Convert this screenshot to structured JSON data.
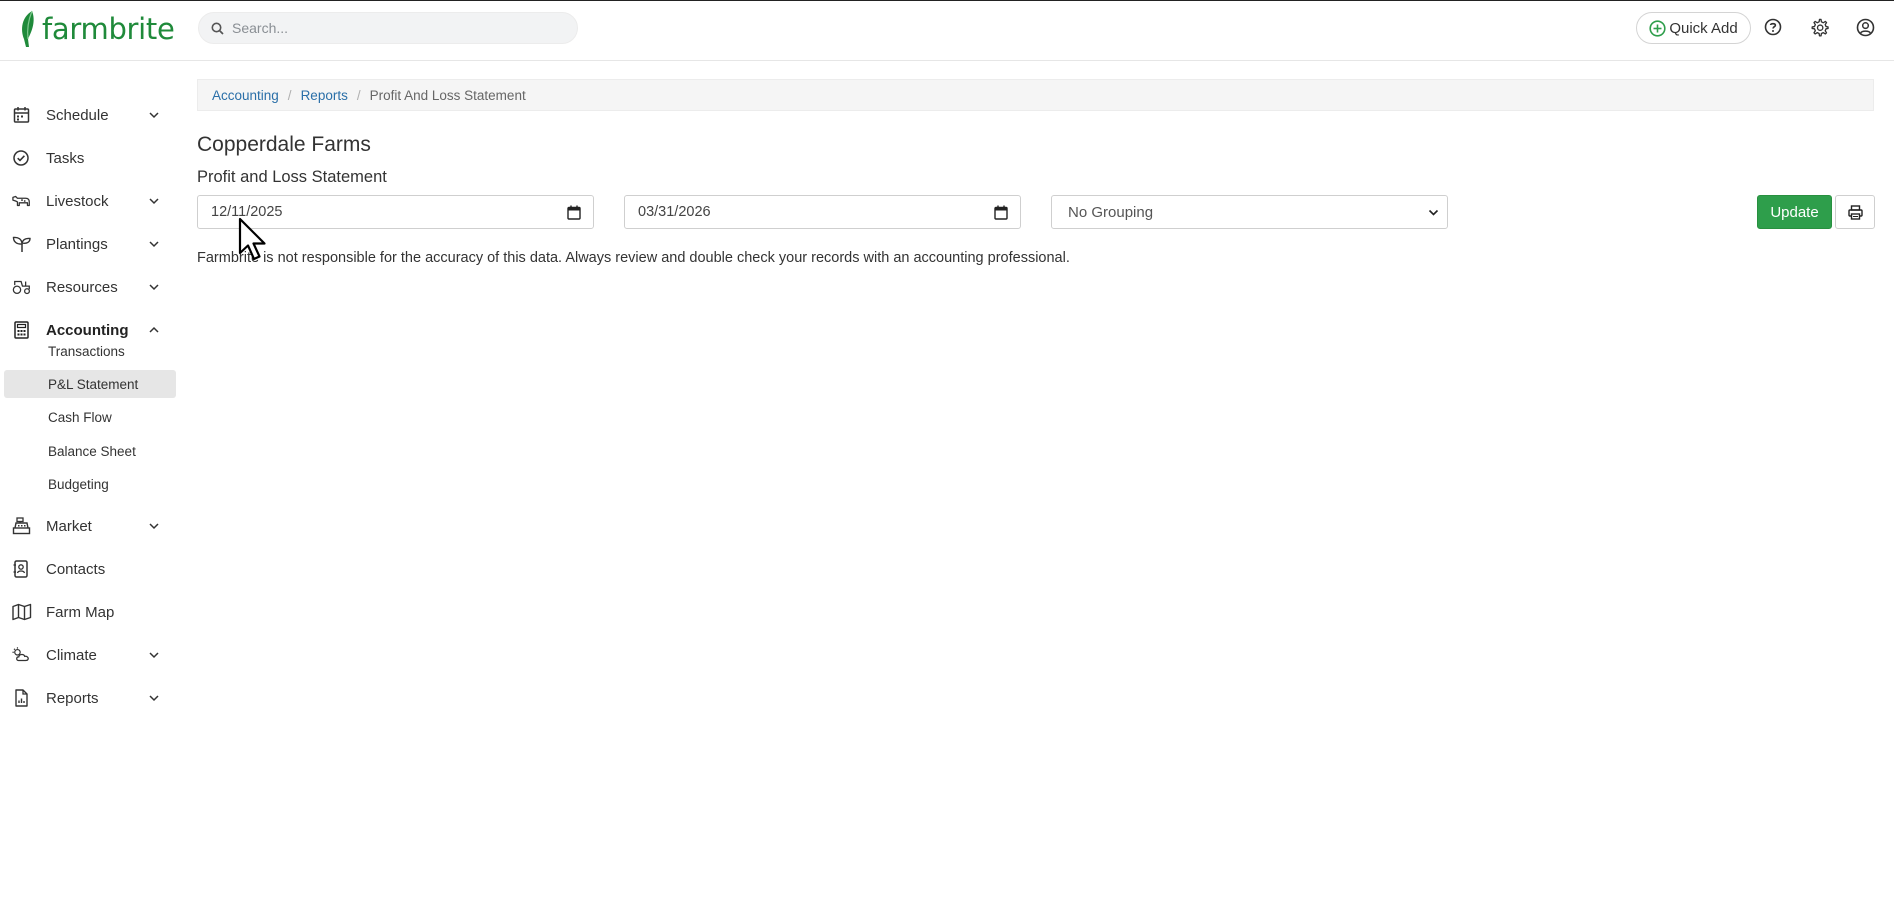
{
  "app": {
    "logo_text": "farmbrite",
    "brand_color": "#2e9e4b"
  },
  "header": {
    "search_placeholder": "Search...",
    "quick_add_label": "Quick Add",
    "icons": [
      "help-icon",
      "gear-icon",
      "user-account-icon"
    ]
  },
  "sidebar": {
    "items": [
      {
        "label": "Schedule",
        "icon": "calendar-icon",
        "expandable": true
      },
      {
        "label": "Tasks",
        "icon": "check-circle-icon",
        "expandable": false
      },
      {
        "label": "Livestock",
        "icon": "cow-icon",
        "expandable": true
      },
      {
        "label": "Plantings",
        "icon": "sprout-icon",
        "expandable": true
      },
      {
        "label": "Resources",
        "icon": "tractor-icon",
        "expandable": true
      },
      {
        "label": "Accounting",
        "icon": "calculator-icon",
        "expandable": true,
        "expanded": true
      },
      {
        "label": "Market",
        "icon": "cash-register-icon",
        "expandable": true
      },
      {
        "label": "Contacts",
        "icon": "address-book-icon",
        "expandable": false
      },
      {
        "label": "Farm Map",
        "icon": "map-icon",
        "expandable": false
      },
      {
        "label": "Climate",
        "icon": "cloud-sun-icon",
        "expandable": true
      },
      {
        "label": "Reports",
        "icon": "report-file-icon",
        "expandable": true
      }
    ],
    "accounting_sub": [
      {
        "label": "Transactions"
      },
      {
        "label": "P&L Statement",
        "selected": true
      },
      {
        "label": "Cash Flow"
      },
      {
        "label": "Balance Sheet"
      },
      {
        "label": "Budgeting"
      }
    ]
  },
  "breadcrumb": {
    "items": [
      "Accounting",
      "Reports"
    ],
    "current": "Profit And Loss Statement"
  },
  "main": {
    "farm_name": "Copperdale Farms",
    "report_title": "Profit and Loss Statement",
    "start_date": "12/11/2025",
    "end_date": "03/31/2026",
    "grouping_selected": "No Grouping",
    "update_label": "Update",
    "disclaimer": "Farmbrite is not responsible for the accuracy of this data. Always review and double check your records with an accounting professional."
  }
}
